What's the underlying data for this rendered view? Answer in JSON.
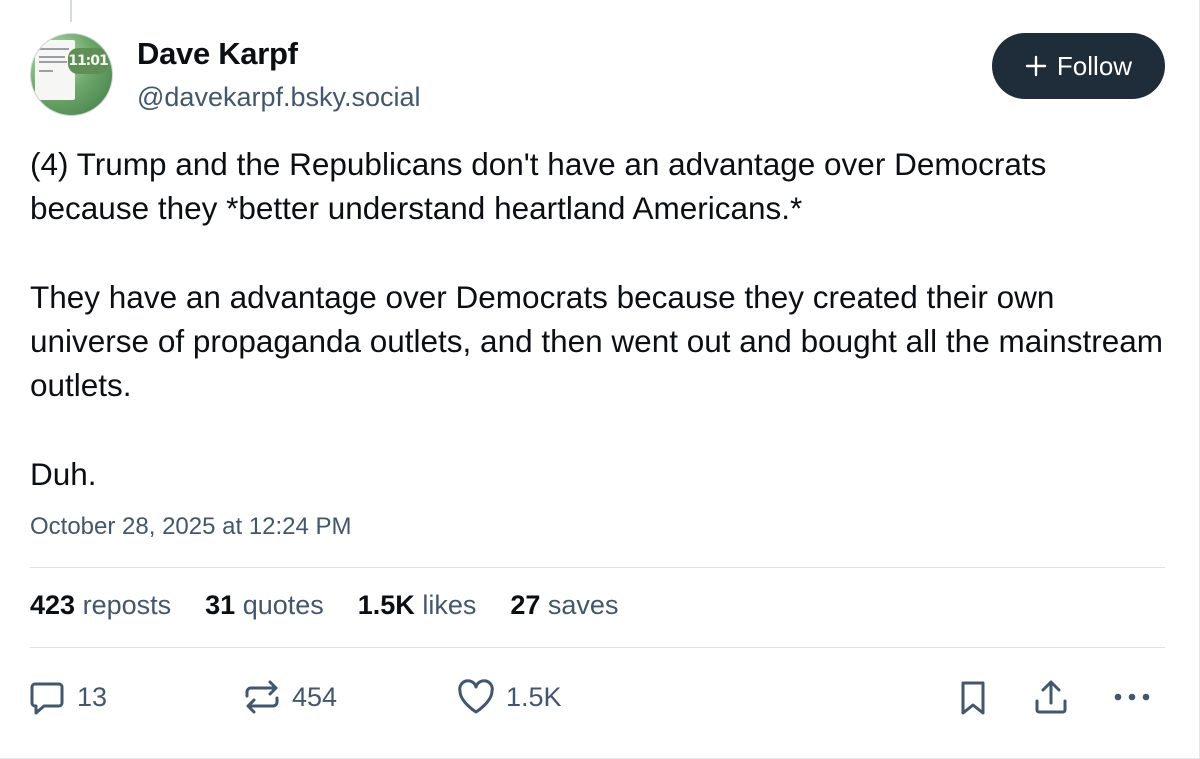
{
  "author": {
    "display_name": "Dave Karpf",
    "handle": "@davekarpf.bsky.social",
    "avatar_text": "11:01"
  },
  "follow_button": {
    "label": "Follow"
  },
  "post": {
    "paragraphs": [
      "(4) Trump and the Republicans don't have an advantage over Democrats because they *better understand heartland Americans.*",
      "They have an advantage over Democrats because they created their own universe of propaganda outlets, and then went out and bought all the mainstream outlets.",
      "Duh."
    ],
    "timestamp": "October 28, 2025 at 12:24 PM"
  },
  "stats": {
    "reposts": {
      "count": "423",
      "label": "reposts"
    },
    "quotes": {
      "count": "31",
      "label": "quotes"
    },
    "likes": {
      "count": "1.5K",
      "label": "likes"
    },
    "saves": {
      "count": "27",
      "label": "saves"
    }
  },
  "actions": {
    "reply_count": "13",
    "repost_count": "454",
    "like_count": "1.5K",
    "icons": [
      "reply-icon",
      "repost-icon",
      "heart-icon",
      "bookmark-icon",
      "share-icon",
      "more-icon"
    ]
  },
  "colors": {
    "text": "#0b0f14",
    "muted": "#42576c",
    "follow_bg": "#1f2c3a",
    "divider": "#dde3e8"
  }
}
